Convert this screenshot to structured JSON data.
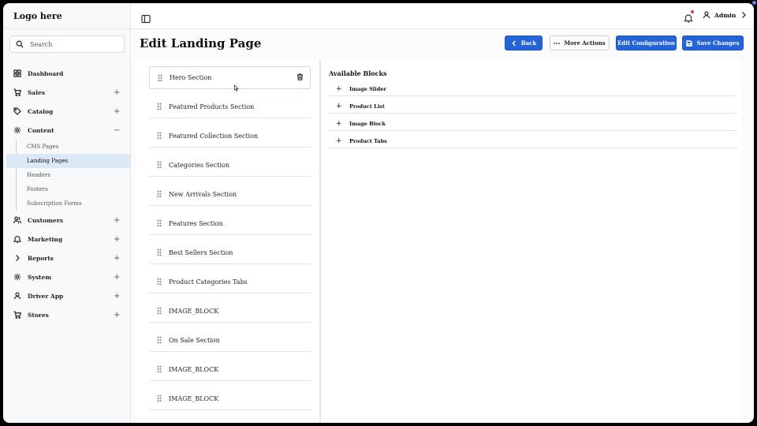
{
  "app": {
    "logo": "Logo here"
  },
  "search": {
    "placeholder": "Search"
  },
  "sidebar": {
    "items": [
      {
        "label": "Dashboard",
        "icon": "grid-icon",
        "expander": ""
      },
      {
        "label": "Sales",
        "icon": "cart-icon",
        "expander": "+"
      },
      {
        "label": "Catalog",
        "icon": "tag-icon",
        "expander": "+"
      },
      {
        "label": "Content",
        "icon": "gear-icon",
        "expander": "−"
      },
      {
        "label": "Customers",
        "icon": "users-icon",
        "expander": "+"
      },
      {
        "label": "Marketing",
        "icon": "bell-icon",
        "expander": "+"
      },
      {
        "label": "Reports",
        "icon": "chevron-right-icon",
        "expander": "+"
      },
      {
        "label": "System",
        "icon": "gear-icon",
        "expander": "+"
      },
      {
        "label": "Driver App",
        "icon": "user-icon",
        "expander": "+"
      },
      {
        "label": "Stores",
        "icon": "cart-icon",
        "expander": "+"
      }
    ],
    "content_children": [
      "CMS Pages",
      "Landing Pages",
      "Headers",
      "Footers",
      "Subscription Forms"
    ],
    "active_child": "Landing Pages"
  },
  "header": {
    "user_name": "Admin",
    "notification_color": "#e23b3b"
  },
  "page": {
    "title": "Edit Landing Page",
    "actions": {
      "back": "Back",
      "more": "More Actions",
      "edit_config": "Edit Configuration",
      "save": "Save Changes"
    }
  },
  "sections": [
    "Hero Section",
    "Featured Products Section",
    "Featured Collection Section",
    "Categories Section",
    "New Arrivals Section",
    "Features Section",
    "Best Sellers Section",
    "Product Categories Tabs",
    "IMAGE_BLOCK",
    "On Sale Section",
    "IMAGE_BLOCK",
    "IMAGE_BLOCK"
  ],
  "blocks": {
    "title": "Available Blocks",
    "items": [
      "Image Slider",
      "Product List",
      "Image Block",
      "Product Tabs"
    ]
  },
  "colors": {
    "accent": "#2563d9",
    "active_nav": "#dbe9f7"
  }
}
